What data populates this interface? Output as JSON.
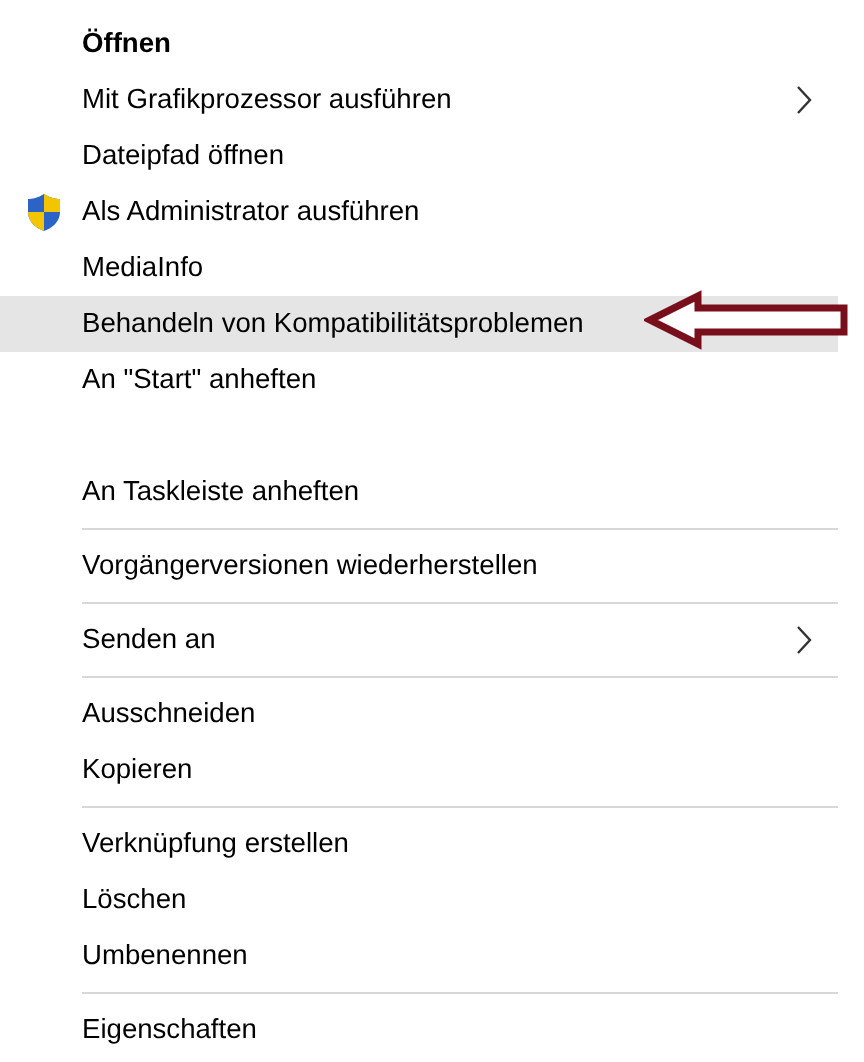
{
  "menu": {
    "items": [
      {
        "kind": "item",
        "label": "Öffnen",
        "default": true,
        "submenu": false,
        "selected": false
      },
      {
        "kind": "item",
        "label": "Mit Grafikprozessor ausführen",
        "default": false,
        "submenu": true,
        "selected": false
      },
      {
        "kind": "item",
        "label": "Dateipfad öffnen",
        "default": false,
        "submenu": false,
        "selected": false
      },
      {
        "kind": "shield_item",
        "label": "Als Administrator ausführen",
        "default": false,
        "submenu": false,
        "selected": false
      },
      {
        "kind": "item",
        "label": "MediaInfo",
        "default": false,
        "submenu": false,
        "selected": false
      },
      {
        "kind": "item",
        "label": "Behandeln von Kompatibilitätsproblemen",
        "default": false,
        "submenu": false,
        "selected": true,
        "annotated": true
      },
      {
        "kind": "item",
        "label": "An \"Start\" anheften",
        "default": false,
        "submenu": false,
        "selected": false
      },
      {
        "kind": "spacer"
      },
      {
        "kind": "item",
        "label": "An Taskleiste anheften",
        "default": false,
        "submenu": false,
        "selected": false
      },
      {
        "kind": "separator"
      },
      {
        "kind": "item",
        "label": "Vorgängerversionen wiederherstellen",
        "default": false,
        "submenu": false,
        "selected": false
      },
      {
        "kind": "separator"
      },
      {
        "kind": "item",
        "label": "Senden an",
        "default": false,
        "submenu": true,
        "selected": false
      },
      {
        "kind": "separator"
      },
      {
        "kind": "item",
        "label": "Ausschneiden",
        "default": false,
        "submenu": false,
        "selected": false
      },
      {
        "kind": "item",
        "label": "Kopieren",
        "default": false,
        "submenu": false,
        "selected": false
      },
      {
        "kind": "separator"
      },
      {
        "kind": "item",
        "label": "Verknüpfung erstellen",
        "default": false,
        "submenu": false,
        "selected": false
      },
      {
        "kind": "item",
        "label": "Löschen",
        "default": false,
        "submenu": false,
        "selected": false
      },
      {
        "kind": "item",
        "label": "Umbenennen",
        "default": false,
        "submenu": false,
        "selected": false
      },
      {
        "kind": "separator"
      },
      {
        "kind": "item",
        "label": "Eigenschaften",
        "default": false,
        "submenu": false,
        "selected": false
      }
    ]
  }
}
